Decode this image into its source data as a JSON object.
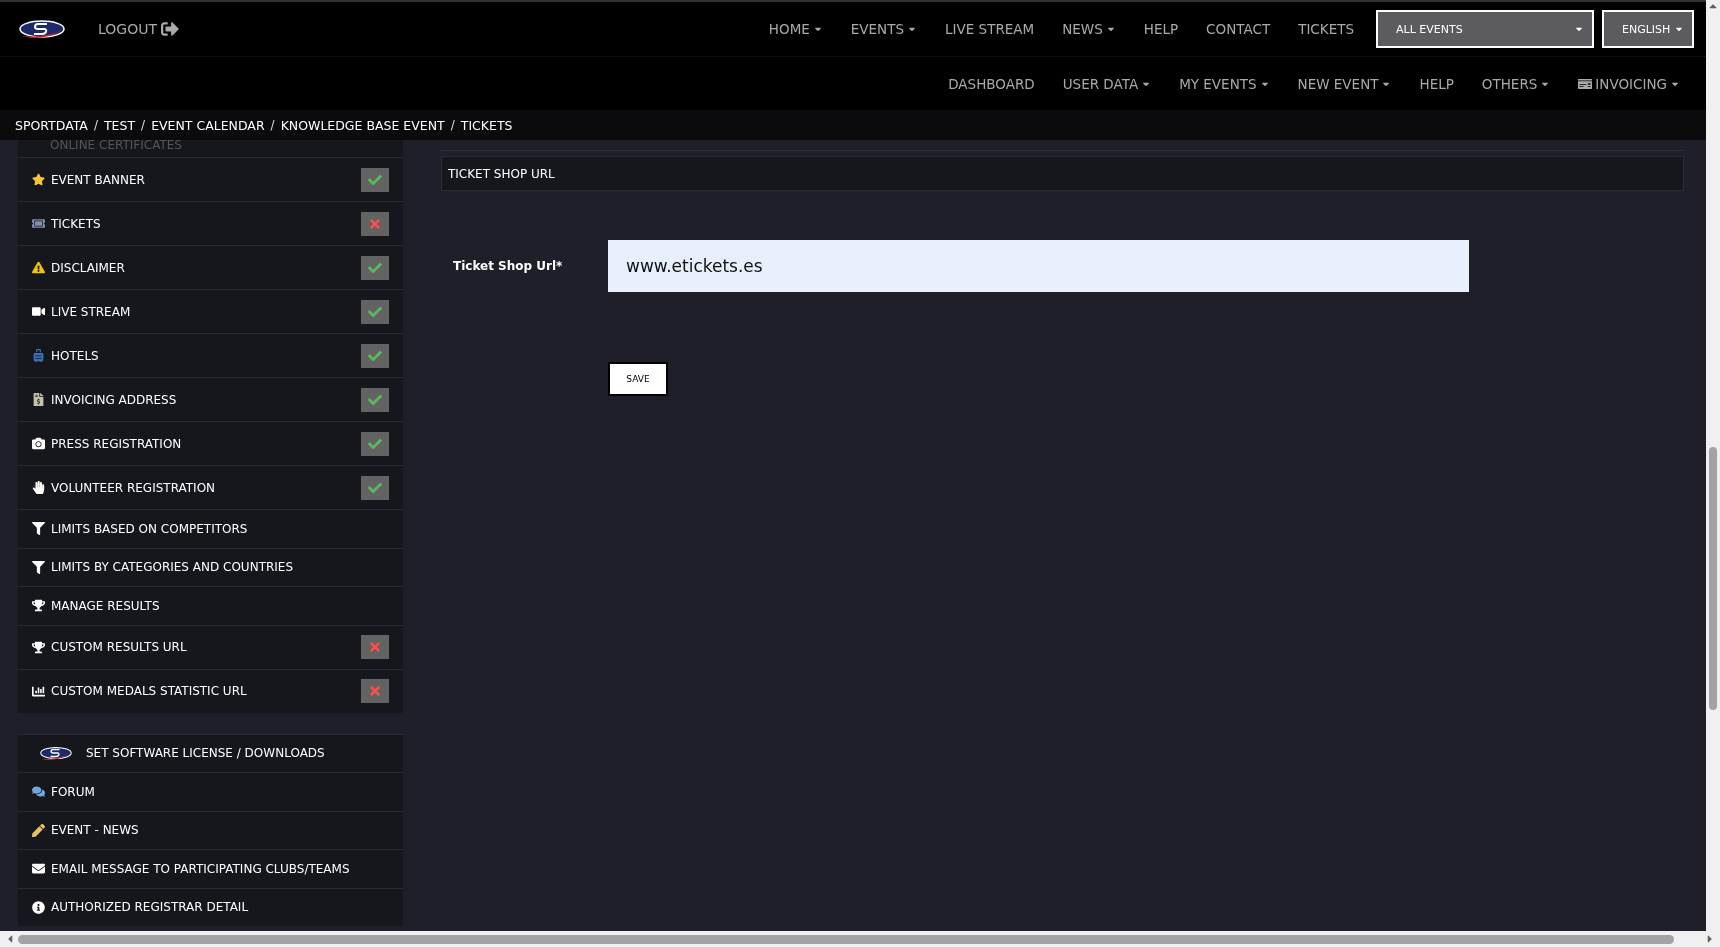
{
  "header": {
    "logout": "LOGOUT",
    "nav": [
      {
        "label": "HOME",
        "dropdown": true
      },
      {
        "label": "EVENTS",
        "dropdown": true
      },
      {
        "label": "LIVE STREAM",
        "dropdown": false
      },
      {
        "label": "NEWS",
        "dropdown": true
      },
      {
        "label": "HELP",
        "dropdown": false
      },
      {
        "label": "CONTACT",
        "dropdown": false
      },
      {
        "label": "TICKETS",
        "dropdown": false
      }
    ],
    "event_select": "ALL EVENTS",
    "language_select": "ENGLISH"
  },
  "subnav": [
    {
      "label": "DASHBOARD",
      "dropdown": false
    },
    {
      "label": "USER DATA",
      "dropdown": true
    },
    {
      "label": "MY EVENTS",
      "dropdown": true
    },
    {
      "label": "NEW EVENT",
      "dropdown": true
    },
    {
      "label": "HELP",
      "dropdown": false
    },
    {
      "label": "OTHERS",
      "dropdown": true
    },
    {
      "label": "INVOICING",
      "dropdown": true
    }
  ],
  "breadcrumb": [
    {
      "label": "SPORTDATA",
      "separator": "/"
    },
    {
      "label": "TEST",
      "separator": "/"
    },
    {
      "label": "EVENT CALENDAR",
      "separator": "/"
    },
    {
      "label": "KNOWLEDGE BASE EVENT",
      "separator": "/"
    },
    {
      "label": "TICKETS"
    }
  ],
  "sidebar": {
    "partial_item": "ONLINE CERTIFICATES",
    "items": [
      {
        "label": "EVENT BANNER",
        "done": true
      },
      {
        "label": "TICKETS",
        "done": false
      },
      {
        "label": "DISCLAIMER",
        "done": true
      },
      {
        "label": "LIVE STREAM",
        "done": true
      },
      {
        "label": "HOTELS",
        "done": true
      },
      {
        "label": "INVOICING ADDRESS",
        "done": true
      },
      {
        "label": "PRESS REGISTRATION",
        "done": true
      },
      {
        "label": "VOLUNTEER REGISTRATION",
        "done": true
      },
      {
        "label": "LIMITS BASED ON COMPETITORS"
      },
      {
        "label": "LIMITS BY CATEGORIES AND COUNTRIES"
      },
      {
        "label": "MANAGE RESULTS"
      },
      {
        "label": "CUSTOM RESULTS URL",
        "done": false
      },
      {
        "label": "CUSTOM MEDALS STATISTIC URL",
        "done": false
      }
    ],
    "tools": [
      {
        "label": "SET SOFTWARE LICENSE / DOWNLOADS"
      },
      {
        "label": "FORUM"
      },
      {
        "label": "EVENT - NEWS"
      },
      {
        "label": "EMAIL MESSAGE TO PARTICIPATING CLUBS/TEAMS"
      },
      {
        "label": "AUTHORIZED REGISTRAR DETAIL"
      }
    ]
  },
  "section_title": "TICKET SHOP URL",
  "form": {
    "label": "Ticket Shop Url*",
    "value": "www.etickets.es",
    "save": "SAVE"
  }
}
